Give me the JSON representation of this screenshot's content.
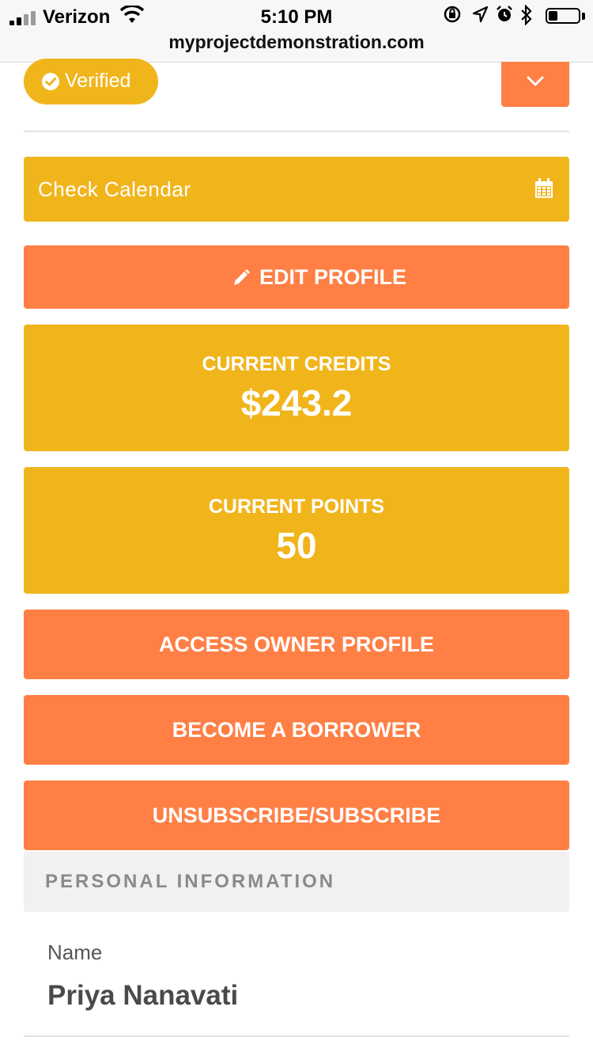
{
  "status_bar": {
    "carrier": "Verizon",
    "time": "5:10 PM",
    "url": "myprojectdemonstration.com",
    "battery_level": 0.3,
    "icons": [
      "signal-icon",
      "wifi-icon",
      "orientation-lock-icon",
      "location-icon",
      "alarm-icon",
      "bluetooth-icon",
      "battery-icon"
    ]
  },
  "profile": {
    "verified_label": "Verified",
    "calendar_placeholder": "Check Calendar",
    "edit_label": "EDIT PROFILE",
    "credits": {
      "label": "CURRENT CREDITS",
      "value": "$243.2"
    },
    "points": {
      "label": "CURRENT POINTS",
      "value": "50"
    },
    "actions": {
      "owner": "ACCESS OWNER PROFILE",
      "borrower": "BECOME A BORROWER",
      "subscribe": "UNSUBSCRIBE/SUBSCRIBE"
    }
  },
  "personal_info": {
    "header": "PERSONAL INFORMATION",
    "name_label": "Name",
    "name_value": "Priya Nanavati"
  },
  "colors": {
    "accent_yellow": "#f1b51c",
    "accent_orange": "#ff7f45",
    "section_bg": "#f1f1f1"
  }
}
